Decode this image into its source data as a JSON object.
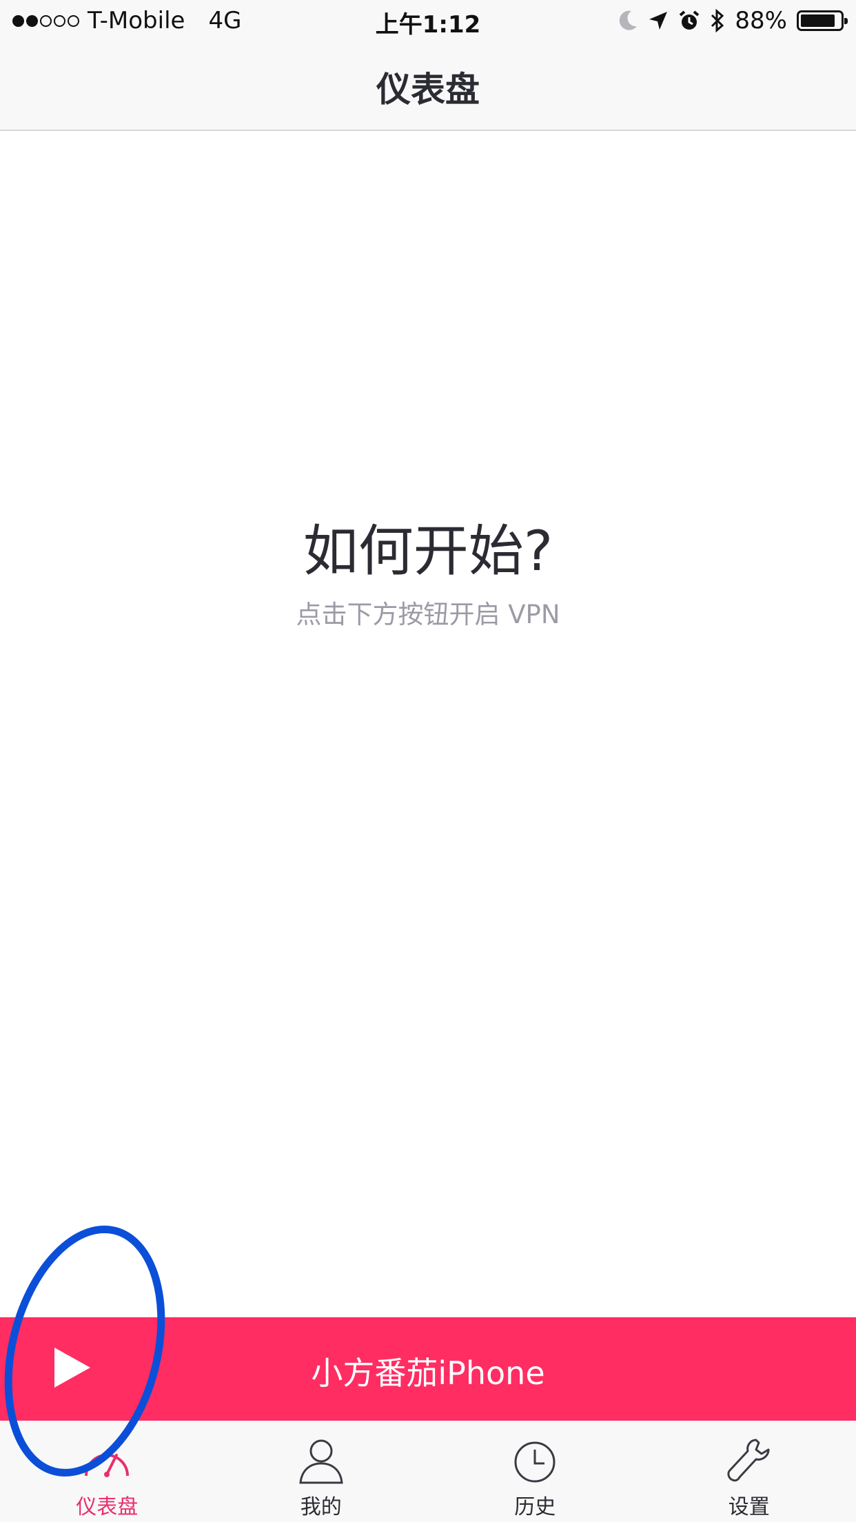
{
  "status_bar": {
    "carrier": "T-Mobile",
    "network": "4G",
    "time": "上午1:12",
    "battery": "88%",
    "battery_level": 0.88,
    "signal_bars_filled": 2,
    "signal_bars_total": 5,
    "icons": [
      "moon-icon",
      "location-arrow-icon",
      "alarm-icon",
      "bluetooth-icon",
      "battery-icon"
    ]
  },
  "nav": {
    "title": "仪表盘"
  },
  "main": {
    "heading": "如何开始?",
    "subtext": "点击下方按钮开启 VPN"
  },
  "play_bar": {
    "label": "小方番茄iPhone",
    "background": "#ff2d62",
    "icon": "play-icon"
  },
  "tabs": [
    {
      "label": "仪表盘",
      "icon": "dashboard-gauge-icon",
      "active": true
    },
    {
      "label": "我的",
      "icon": "user-icon",
      "active": false
    },
    {
      "label": "历史",
      "icon": "clock-icon",
      "active": false
    },
    {
      "label": "设置",
      "icon": "wrench-icon",
      "active": false
    }
  ],
  "colors": {
    "accent": "#ff2d62",
    "active_tab": "#e8306a",
    "annotation": "#0b4fd8"
  }
}
